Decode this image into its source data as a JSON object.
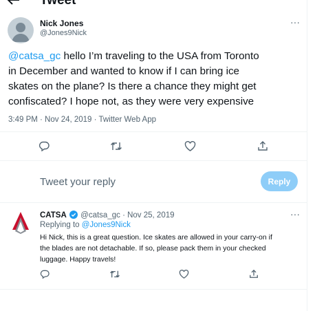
{
  "header": {
    "title": "Tweet",
    "back_icon": "arrow-left-icon"
  },
  "main_tweet": {
    "author_name": "Nick Jones",
    "author_handle": "@Jones9Nick",
    "more_icon": "more-horizontal-icon",
    "mention": "@catsa_gc",
    "text_line1": " hello I’m traveling to the USA from Toronto",
    "text_line2": "in December and wanted to know if I can bring ice",
    "text_line3": "skates on the plane? Is there a chance they might get",
    "text_line4": "confiscated? I hope not, as they were very expensive",
    "timestamp": "3:49 PM · Nov 24, 2019 · Twitter Web App",
    "actions": [
      "reply-icon",
      "retweet-icon",
      "like-icon",
      "share-icon"
    ]
  },
  "reply_box": {
    "placeholder": "Tweet your reply",
    "button_label": "Reply"
  },
  "reply_tweet": {
    "author_name": "CATSA",
    "verified_icon": "verified-badge-icon",
    "handle_date": "@catsa_gc · Nov 25, 2019",
    "replying_prefix": "Replying to ",
    "replying_handle": "@Jones9Nick",
    "text_line1": "Hi Nick, this is a great question. Ice skates are allowed in your carry-on if",
    "text_line2": "the blades are not detachable. If so, please pack them in your checked",
    "text_line3": "luggage. Happy travels!",
    "actions": [
      "reply-icon",
      "retweet-icon",
      "like-icon",
      "share-icon"
    ]
  },
  "colors": {
    "accent": "#1d9bf0",
    "reply_button": "#8ecdf8",
    "catsa_red": "#c8102e"
  }
}
